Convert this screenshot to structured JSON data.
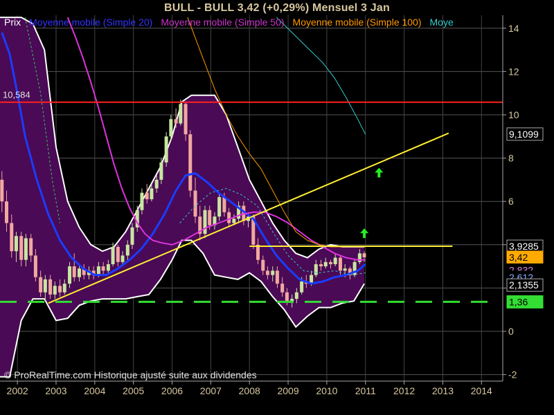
{
  "header": {
    "title": "BULL - BULL     3,42 (+0,29%)     Mensuel  3 Jan"
  },
  "legend": [
    {
      "label": "Prix",
      "color": "#ffffff"
    },
    {
      "label": "Moyenne mobile (Simple 20)",
      "color": "#3333ff"
    },
    {
      "label": "Moyenne mobile (Simple 50)",
      "color": "#cc33cc"
    },
    {
      "label": "Moyenne mobile (Simple 100)",
      "color": "#ff9900"
    },
    {
      "label": "Moye",
      "color": "#33cccc"
    }
  ],
  "footer": {
    "copyright": "© ProRealTime.com Historique ajusté suite aux dividendes"
  },
  "colors": {
    "background": "#000000",
    "bollinger_fill": "#4a0a55",
    "bollinger_edge": "#ffffff",
    "candle_up": "#c8e6a0",
    "candle_down": "#f0a8a0",
    "ma20": "#1a3cff",
    "ma50": "#dd33dd",
    "ma100": "#ff9900",
    "ma200": "#33cccc",
    "resistance": "#ff2020",
    "trendline": "#ffee33",
    "support": "#33dd33",
    "signal_arrow": "#22ee22"
  },
  "chart_data": {
    "type": "line",
    "y_axis": {
      "position": "right",
      "ylim": [
        -2.3,
        14.6
      ],
      "ticks": [
        -2,
        0,
        2,
        4,
        6,
        8,
        10,
        12,
        14
      ]
    },
    "x_axis": {
      "xlim": [
        2001.55,
        2014.55
      ],
      "ticks": [
        2002,
        2003,
        2004,
        2005,
        2006,
        2007,
        2008,
        2009,
        2010,
        2011,
        2012,
        2013,
        2014
      ]
    },
    "grid": true,
    "candles": [
      {
        "x": 2001.6,
        "open": 7.0,
        "high": 7.4,
        "low": 5.5,
        "close": 6.0
      },
      {
        "x": 2001.72,
        "open": 6.0,
        "high": 6.5,
        "low": 4.6,
        "close": 5.0
      },
      {
        "x": 2001.85,
        "open": 5.0,
        "high": 5.4,
        "low": 3.4,
        "close": 3.7
      },
      {
        "x": 2001.97,
        "open": 3.7,
        "high": 4.6,
        "low": 3.2,
        "close": 4.4
      },
      {
        "x": 2002.1,
        "open": 4.4,
        "high": 4.6,
        "low": 3.0,
        "close": 3.3
      },
      {
        "x": 2002.22,
        "open": 3.3,
        "high": 4.5,
        "low": 3.0,
        "close": 4.3
      },
      {
        "x": 2002.35,
        "open": 4.3,
        "high": 4.5,
        "low": 3.2,
        "close": 3.5
      },
      {
        "x": 2002.47,
        "open": 3.5,
        "high": 3.8,
        "low": 2.3,
        "close": 2.5
      },
      {
        "x": 2002.6,
        "open": 2.5,
        "high": 2.8,
        "low": 1.6,
        "close": 1.8
      },
      {
        "x": 2002.72,
        "open": 1.8,
        "high": 2.6,
        "low": 1.4,
        "close": 2.4
      },
      {
        "x": 2002.85,
        "open": 2.4,
        "high": 2.6,
        "low": 1.5,
        "close": 1.7
      },
      {
        "x": 2002.97,
        "open": 1.7,
        "high": 2.3,
        "low": 1.5,
        "close": 2.1
      },
      {
        "x": 2003.1,
        "open": 2.1,
        "high": 2.4,
        "low": 1.6,
        "close": 1.8
      },
      {
        "x": 2003.22,
        "open": 1.8,
        "high": 2.4,
        "low": 1.7,
        "close": 2.2
      },
      {
        "x": 2003.35,
        "open": 2.2,
        "high": 3.2,
        "low": 2.0,
        "close": 3.0
      },
      {
        "x": 2003.47,
        "open": 3.0,
        "high": 3.6,
        "low": 2.3,
        "close": 2.5
      },
      {
        "x": 2003.6,
        "open": 2.5,
        "high": 3.1,
        "low": 2.3,
        "close": 2.9
      },
      {
        "x": 2003.72,
        "open": 2.9,
        "high": 3.1,
        "low": 2.4,
        "close": 2.6
      },
      {
        "x": 2003.85,
        "open": 2.6,
        "high": 3.0,
        "low": 2.4,
        "close": 2.8
      },
      {
        "x": 2003.97,
        "open": 2.8,
        "high": 3.0,
        "low": 2.4,
        "close": 2.6
      },
      {
        "x": 2004.1,
        "open": 2.6,
        "high": 3.2,
        "low": 2.5,
        "close": 3.0
      },
      {
        "x": 2004.22,
        "open": 3.0,
        "high": 3.2,
        "low": 2.6,
        "close": 2.8
      },
      {
        "x": 2004.35,
        "open": 2.8,
        "high": 3.3,
        "low": 2.6,
        "close": 3.1
      },
      {
        "x": 2004.47,
        "open": 3.1,
        "high": 4.1,
        "low": 3.0,
        "close": 3.9
      },
      {
        "x": 2004.6,
        "open": 3.9,
        "high": 4.0,
        "low": 3.0,
        "close": 3.2
      },
      {
        "x": 2004.72,
        "open": 3.2,
        "high": 3.7,
        "low": 3.0,
        "close": 3.5
      },
      {
        "x": 2004.85,
        "open": 3.5,
        "high": 4.2,
        "low": 3.3,
        "close": 4.0
      },
      {
        "x": 2004.97,
        "open": 4.0,
        "high": 5.0,
        "low": 3.8,
        "close": 4.8
      },
      {
        "x": 2005.1,
        "open": 4.8,
        "high": 5.8,
        "low": 4.6,
        "close": 5.6
      },
      {
        "x": 2005.22,
        "open": 5.6,
        "high": 6.6,
        "low": 5.4,
        "close": 6.4
      },
      {
        "x": 2005.35,
        "open": 6.4,
        "high": 6.8,
        "low": 5.9,
        "close": 6.1
      },
      {
        "x": 2005.47,
        "open": 6.1,
        "high": 6.8,
        "low": 6.0,
        "close": 6.6
      },
      {
        "x": 2005.6,
        "open": 6.6,
        "high": 7.2,
        "low": 6.4,
        "close": 7.0
      },
      {
        "x": 2005.72,
        "open": 7.0,
        "high": 8.0,
        "low": 6.8,
        "close": 7.8
      },
      {
        "x": 2005.85,
        "open": 7.8,
        "high": 9.2,
        "low": 7.6,
        "close": 9.0
      },
      {
        "x": 2005.97,
        "open": 9.0,
        "high": 10.0,
        "low": 8.8,
        "close": 9.8
      },
      {
        "x": 2006.1,
        "open": 9.8,
        "high": 10.3,
        "low": 9.4,
        "close": 9.6
      },
      {
        "x": 2006.22,
        "open": 9.6,
        "high": 10.7,
        "low": 9.5,
        "close": 10.5
      },
      {
        "x": 2006.35,
        "open": 10.5,
        "high": 10.6,
        "low": 8.8,
        "close": 9.1
      },
      {
        "x": 2006.47,
        "open": 9.1,
        "high": 9.3,
        "low": 6.2,
        "close": 6.5
      },
      {
        "x": 2006.6,
        "open": 6.5,
        "high": 7.1,
        "low": 5.0,
        "close": 5.3
      },
      {
        "x": 2006.72,
        "open": 5.3,
        "high": 5.8,
        "low": 4.2,
        "close": 4.5
      },
      {
        "x": 2006.85,
        "open": 4.5,
        "high": 5.8,
        "low": 4.3,
        "close": 5.6
      },
      {
        "x": 2006.97,
        "open": 5.6,
        "high": 5.8,
        "low": 4.7,
        "close": 4.9
      },
      {
        "x": 2007.1,
        "open": 4.9,
        "high": 5.5,
        "low": 4.7,
        "close": 5.3
      },
      {
        "x": 2007.22,
        "open": 5.3,
        "high": 6.4,
        "low": 5.1,
        "close": 6.2
      },
      {
        "x": 2007.35,
        "open": 6.2,
        "high": 6.4,
        "low": 5.3,
        "close": 5.5
      },
      {
        "x": 2007.47,
        "open": 5.5,
        "high": 5.7,
        "low": 4.8,
        "close": 5.0
      },
      {
        "x": 2007.6,
        "open": 5.0,
        "high": 5.4,
        "low": 4.9,
        "close": 5.2
      },
      {
        "x": 2007.72,
        "open": 5.2,
        "high": 6.0,
        "low": 5.0,
        "close": 5.8
      },
      {
        "x": 2007.85,
        "open": 5.8,
        "high": 6.0,
        "low": 4.9,
        "close": 5.1
      },
      {
        "x": 2007.97,
        "open": 5.1,
        "high": 5.5,
        "low": 4.8,
        "close": 5.3
      },
      {
        "x": 2008.1,
        "open": 5.3,
        "high": 5.4,
        "low": 3.8,
        "close": 4.0
      },
      {
        "x": 2008.22,
        "open": 4.0,
        "high": 4.3,
        "low": 3.1,
        "close": 3.3
      },
      {
        "x": 2008.35,
        "open": 3.3,
        "high": 3.5,
        "low": 2.6,
        "close": 2.8
      },
      {
        "x": 2008.47,
        "open": 2.8,
        "high": 3.0,
        "low": 2.4,
        "close": 2.6
      },
      {
        "x": 2008.6,
        "open": 2.6,
        "high": 3.0,
        "low": 2.3,
        "close": 2.8
      },
      {
        "x": 2008.72,
        "open": 2.8,
        "high": 3.0,
        "low": 2.0,
        "close": 2.2
      },
      {
        "x": 2008.85,
        "open": 2.2,
        "high": 2.5,
        "low": 1.6,
        "close": 1.8
      },
      {
        "x": 2008.97,
        "open": 1.8,
        "high": 2.0,
        "low": 1.2,
        "close": 1.4
      },
      {
        "x": 2009.1,
        "open": 1.4,
        "high": 1.7,
        "low": 1.1,
        "close": 1.5
      },
      {
        "x": 2009.22,
        "open": 1.5,
        "high": 2.0,
        "low": 1.3,
        "close": 1.8
      },
      {
        "x": 2009.35,
        "open": 1.8,
        "high": 2.5,
        "low": 1.7,
        "close": 2.3
      },
      {
        "x": 2009.47,
        "open": 2.3,
        "high": 2.6,
        "low": 2.0,
        "close": 2.2
      },
      {
        "x": 2009.6,
        "open": 2.2,
        "high": 2.8,
        "low": 2.1,
        "close": 2.6
      },
      {
        "x": 2009.72,
        "open": 2.6,
        "high": 3.3,
        "low": 2.5,
        "close": 3.1
      },
      {
        "x": 2009.85,
        "open": 3.1,
        "high": 3.3,
        "low": 2.8,
        "close": 3.0
      },
      {
        "x": 2009.97,
        "open": 3.0,
        "high": 3.4,
        "low": 2.9,
        "close": 3.2
      },
      {
        "x": 2010.1,
        "open": 3.2,
        "high": 3.3,
        "low": 2.9,
        "close": 3.1
      },
      {
        "x": 2010.22,
        "open": 3.1,
        "high": 3.6,
        "low": 3.0,
        "close": 3.4
      },
      {
        "x": 2010.35,
        "open": 3.4,
        "high": 3.5,
        "low": 2.6,
        "close": 2.8
      },
      {
        "x": 2010.47,
        "open": 2.8,
        "high": 3.1,
        "low": 2.5,
        "close": 2.9
      },
      {
        "x": 2010.6,
        "open": 2.9,
        "high": 3.0,
        "low": 2.4,
        "close": 2.6
      },
      {
        "x": 2010.72,
        "open": 2.6,
        "high": 3.3,
        "low": 2.5,
        "close": 3.2
      },
      {
        "x": 2010.85,
        "open": 3.2,
        "high": 3.8,
        "low": 3.1,
        "close": 3.6
      },
      {
        "x": 2010.97,
        "open": 3.6,
        "high": 3.7,
        "low": 3.2,
        "close": 3.42
      }
    ],
    "series": [
      {
        "name": "Moyenne mobile (Simple 20)",
        "color": "#1a3cff",
        "width": 3,
        "dashed": false,
        "x": [
          2001.6,
          2001.8,
          2002.0,
          2002.2,
          2002.5,
          2002.8,
          2003.1,
          2003.4,
          2003.7,
          2004.0,
          2004.3,
          2004.6,
          2004.9,
          2005.2,
          2005.5,
          2005.8,
          2006.1,
          2006.35,
          2006.6,
          2006.9,
          2007.2,
          2007.5,
          2007.8,
          2008.1,
          2008.4,
          2008.7,
          2009.0,
          2009.3,
          2009.6,
          2009.9,
          2010.2,
          2010.5,
          2010.8,
          2011.0
        ],
        "y": [
          13.8,
          12.8,
          11.0,
          9.0,
          7.0,
          5.4,
          4.2,
          3.4,
          2.9,
          2.6,
          2.6,
          2.9,
          3.3,
          3.8,
          4.5,
          5.4,
          6.5,
          7.2,
          7.3,
          6.9,
          6.4,
          6.0,
          5.6,
          5.2,
          4.3,
          3.5,
          2.9,
          2.4,
          2.2,
          2.3,
          2.5,
          2.6,
          2.8,
          3.1
        ]
      },
      {
        "name": "Moyenne mobile (Simple 50)",
        "color": "#dd33dd",
        "width": 2,
        "dashed": false,
        "x": [
          2003.3,
          2003.5,
          2003.7,
          2003.9,
          2004.1,
          2004.3,
          2004.5,
          2004.7,
          2004.9,
          2005.1,
          2005.3,
          2005.5,
          2005.7,
          2006.0,
          2006.3,
          2006.6,
          2006.9,
          2007.2,
          2007.5,
          2007.8,
          2008.1,
          2008.4,
          2008.7,
          2009.0,
          2009.3,
          2009.6,
          2009.9,
          2010.2,
          2010.5,
          2010.8,
          2011.0
        ],
        "y": [
          14.5,
          13.6,
          12.6,
          11.5,
          10.3,
          9.0,
          7.7,
          6.6,
          5.7,
          5.0,
          4.5,
          4.2,
          4.1,
          4.0,
          4.2,
          4.5,
          4.8,
          5.0,
          5.2,
          5.4,
          5.5,
          5.5,
          5.3,
          5.0,
          4.6,
          4.2,
          3.9,
          3.6,
          3.4,
          3.3,
          3.3
        ]
      },
      {
        "name": "Moyenne mobile (Simple 100)",
        "color": "#ff9900",
        "width": 1,
        "dashed": false,
        "x": [
          2006.4,
          2006.8,
          2007.1,
          2007.4,
          2007.7,
          2008.0,
          2008.3,
          2008.6,
          2008.9,
          2009.2,
          2009.5,
          2009.8,
          2010.1,
          2010.4,
          2010.7,
          2011.0
        ],
        "y": [
          14.5,
          12.6,
          11.2,
          10.0,
          9.0,
          8.2,
          7.5,
          6.5,
          5.5,
          4.6,
          4.2,
          4.0,
          3.9,
          3.9,
          3.9,
          3.9
        ]
      },
      {
        "name": "Moye",
        "color": "#33cccc",
        "width": 1,
        "dashed": false,
        "x": [
          2008.7,
          2009.1,
          2009.5,
          2009.9,
          2010.2,
          2010.5,
          2010.8,
          2011.0
        ],
        "y": [
          14.5,
          13.8,
          13.1,
          12.4,
          11.7,
          10.8,
          9.8,
          9.1
        ]
      },
      {
        "name": "",
        "color": "#33cccc",
        "width": 1,
        "dashed": true,
        "x": [
          2006.2,
          2006.6,
          2007.0,
          2007.4,
          2007.8,
          2008.2,
          2008.6,
          2009.0,
          2009.4,
          2009.8,
          2010.2,
          2010.6,
          2011.0
        ],
        "y": [
          5.0,
          5.8,
          6.4,
          6.6,
          6.3,
          5.8,
          4.6,
          3.5,
          2.8,
          2.7,
          2.8,
          2.6,
          2.7
        ]
      },
      {
        "name": "",
        "color": "#33cc66",
        "width": 1,
        "dashed": true,
        "x": [
          2002.2,
          2002.6,
          2002.9,
          2003.1
        ],
        "y": [
          14.5,
          11.0,
          7.0,
          5.0
        ]
      }
    ],
    "bollinger": {
      "x": [
        2001.55,
        2001.8,
        2002.1,
        2002.4,
        2002.7,
        2003.0,
        2003.3,
        2003.6,
        2003.9,
        2004.2,
        2004.5,
        2004.8,
        2005.1,
        2005.4,
        2005.7,
        2006.0,
        2006.25,
        2006.5,
        2006.8,
        2007.1,
        2007.4,
        2007.7,
        2008.0,
        2008.3,
        2008.6,
        2008.9,
        2009.2,
        2009.5,
        2009.8,
        2010.1,
        2010.4,
        2010.7,
        2010.97
      ],
      "upper": [
        14.5,
        14.5,
        14.5,
        14.2,
        13.0,
        8.5,
        6.0,
        4.8,
        4.0,
        3.7,
        3.9,
        4.6,
        5.6,
        6.6,
        7.6,
        9.0,
        10.6,
        10.9,
        10.9,
        10.9,
        10.0,
        8.5,
        7.0,
        6.0,
        5.0,
        4.2,
        3.6,
        3.4,
        3.8,
        4.0,
        3.9,
        3.9,
        3.9
      ],
      "lower": [
        -2.1,
        -2.1,
        0.5,
        1.5,
        1.5,
        0.5,
        0.6,
        1.2,
        1.4,
        1.5,
        1.5,
        1.5,
        1.6,
        1.7,
        2.4,
        3.3,
        4.2,
        4.2,
        3.6,
        2.6,
        2.5,
        2.4,
        2.7,
        2.3,
        1.6,
        1.0,
        0.2,
        0.7,
        1.1,
        1.1,
        1.3,
        1.4,
        2.2
      ]
    },
    "lines": [
      {
        "name": "resistance",
        "x1": 2001.55,
        "y1": 10.584,
        "x2": 2014.55,
        "y2": 10.584,
        "color": "#ff2020",
        "width": 2,
        "dashed": false
      },
      {
        "name": "trendline",
        "x1": 2002.8,
        "y1": 1.3,
        "x2": 2013.15,
        "y2": 9.15,
        "color": "#ffee33",
        "width": 2,
        "dashed": false
      },
      {
        "name": "neckline",
        "x1": 2008.0,
        "y1": 3.9285,
        "x2": 2013.25,
        "y2": 3.9285,
        "color": "#ffee33",
        "width": 2,
        "dashed": false
      },
      {
        "name": "support",
        "x1": 2001.55,
        "y1": 1.36,
        "x2": 2014.3,
        "y2": 1.36,
        "color": "#33dd33",
        "width": 3,
        "dashed": true
      }
    ],
    "arrows": [
      {
        "x": 2010.97,
        "y": 4.5
      },
      {
        "x": 2011.35,
        "y": 7.3
      }
    ],
    "annotations": [
      {
        "text": "10,584",
        "x": 2001.55,
        "y": 10.584
      }
    ],
    "price_labels": [
      {
        "text": "9,1099",
        "y": 9.1099,
        "bg": "#000000",
        "fg": "#ffffff",
        "border": "#aaaaaa"
      },
      {
        "text": "3,9285",
        "y": 3.9285,
        "bg": "#000000",
        "fg": "#ffffff",
        "border": "#aaaaaa"
      },
      {
        "text": "3,42",
        "y": 3.42,
        "bg": "#ffaa00",
        "fg": "#000000",
        "border": "#ffaa00"
      },
      {
        "text": "2,832",
        "y": 2.83,
        "bg": "#000000",
        "fg": "#dd88dd",
        "border": "#000000"
      },
      {
        "text": "2,612",
        "y": 2.5,
        "bg": "#000000",
        "fg": "#88aaff",
        "border": "#000000"
      },
      {
        "text": "2,1355",
        "y": 2.1355,
        "bg": "#000000",
        "fg": "#ffffff",
        "border": "#aaaaaa"
      },
      {
        "text": "1,36",
        "y": 1.36,
        "bg": "#33dd33",
        "fg": "#000000",
        "border": "#33dd33"
      }
    ]
  }
}
